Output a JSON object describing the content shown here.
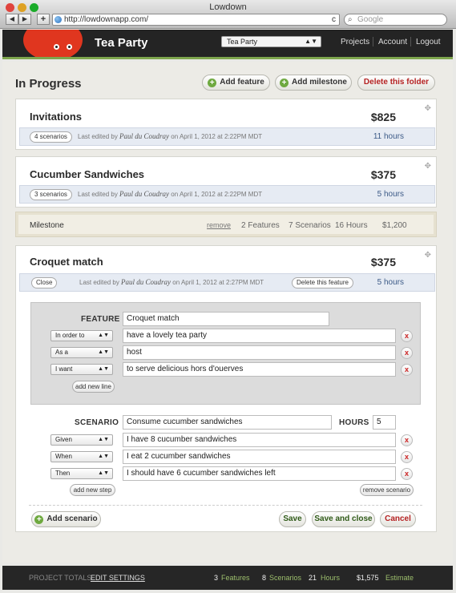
{
  "window": {
    "title": "Lowdown",
    "url": "http://lowdownapp.com/",
    "search_placeholder": "Google",
    "back": "◀",
    "forward": "▶",
    "add_tab": "+",
    "reload": "c"
  },
  "header": {
    "project_title": "Tea Party",
    "project_select": "Tea Party",
    "nav": [
      "Projects",
      "Account",
      "Logout"
    ]
  },
  "page": {
    "heading": "In Progress",
    "actions": {
      "add_feature": "Add feature",
      "add_milestone": "Add milestone",
      "delete_folder": "Delete this folder"
    },
    "features": [
      {
        "title": "Invitations",
        "price": "$825",
        "scenarios": "4 scenarios",
        "edited_prefix": "Last edited by",
        "editor": "Paul du Coudray",
        "edited_suffix": "on April 1, 2012 at 2:22PM MDT",
        "hours": "11 hours"
      },
      {
        "title": "Cucumber Sandwiches",
        "price": "$375",
        "scenarios": "3 scenarios",
        "edited_prefix": "Last edited by",
        "editor": "Paul du Coudray",
        "edited_suffix": "on April 1, 2012 at 2:22PM MDT",
        "hours": "5 hours"
      }
    ],
    "milestone": {
      "label": "Milestone",
      "remove": "remove",
      "features": "2 Features",
      "scenarios": "7 Scenarios",
      "hours": "16 Hours",
      "cost": "$1,200"
    },
    "open_feature": {
      "title": "Croquet match",
      "price": "$375",
      "close": "Close",
      "edited_prefix": "Last edited by",
      "editor": "Paul du Coudray",
      "edited_suffix": "on April 1, 2012 at 2:27PM MDT",
      "delete": "Delete this feature",
      "hours": "5 hours",
      "feature_label": "FEATURE",
      "feature_value": "Croquet match",
      "lines": [
        {
          "key": "In order to",
          "value": "have a lovely tea party"
        },
        {
          "key": "As a",
          "value": "host"
        },
        {
          "key": "I want",
          "value": "to serve delicious hors d'ouerves"
        }
      ],
      "add_line": "add new line",
      "scenario_label": "SCENARIO",
      "scenario_value": "Consume cucumber sandwiches",
      "hours_label": "HOURS",
      "hours_value": "5",
      "steps": [
        {
          "key": "Given",
          "value": "I have 8 cucumber sandwiches"
        },
        {
          "key": "When",
          "value": "I eat 2 cucumber sandwiches"
        },
        {
          "key": "Then",
          "value": "I should have 6 cucumber sandwiches left"
        }
      ],
      "add_step": "add new step",
      "remove_scenario": "remove scenario",
      "add_scenario": "Add scenario",
      "save": "Save",
      "save_close": "Save and close",
      "cancel": "Cancel",
      "remove_glyph": "x",
      "select_arrow": "▲▼"
    }
  },
  "footer": {
    "totals_label": "PROJECT TOTALS",
    "edit_settings": "EDIT SETTINGS",
    "features_n": "3",
    "features_l": "Features",
    "scenarios_n": "8",
    "scenarios_l": "Scenarios",
    "hours_n": "21",
    "hours_l": "Hours",
    "estimate_n": "$1,575",
    "estimate_l": "Estimate"
  }
}
